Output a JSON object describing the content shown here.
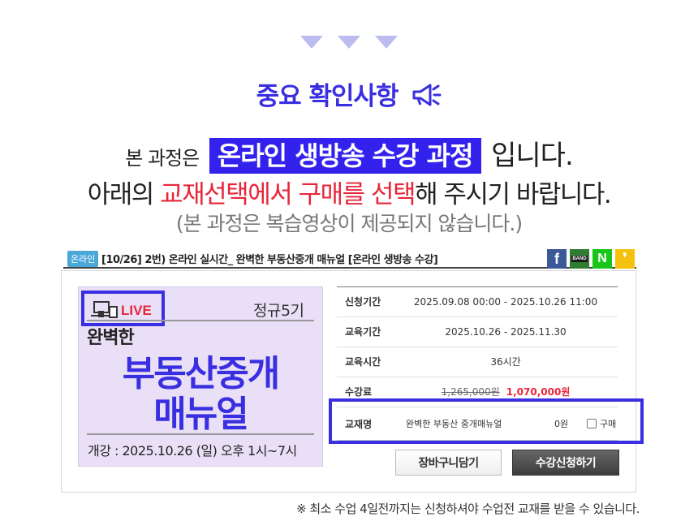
{
  "header": {
    "important_title": "중요 확인사항",
    "line1": {
      "prefix": "본 과정은",
      "highlight": "온라인 생방송 수강 과정",
      "suffix": "입니다."
    },
    "line2": {
      "part1": "아래의 ",
      "red1": "교재선택에서",
      "space": " ",
      "red2": "구매를 선택",
      "part2": "해 주시기 바랍니다."
    },
    "line3": "(본 과정은 복습영상이 제공되지 않습니다.)"
  },
  "course": {
    "badge": "온라인",
    "title": "[10/26] 2번) 온라인 실시간_ 완벽한 부동산중개 매뉴얼 [온라인 생방송 수강]",
    "share": {
      "facebook": "f",
      "band": "BAND",
      "naver": "N",
      "kakao": "❜"
    }
  },
  "thumbnail": {
    "live": "LIVE",
    "regular": "정규5기",
    "perfect": "완벽한",
    "title_line1": "부동산중개",
    "title_line2": "매뉴얼",
    "open_date": "개강 : 2025.10.26 (일) 오후 1시~7시"
  },
  "info": {
    "rows": [
      {
        "label": "신청기간",
        "value": "2025.09.08 00:00 - 2025.10.26 11:00"
      },
      {
        "label": "교육기간",
        "value": "2025.10.26 - 2025.11.30"
      },
      {
        "label": "교육시간",
        "value": "36시간"
      }
    ],
    "fee": {
      "label": "수강료",
      "original": "1,265,000원",
      "sale": "1,070,000원"
    },
    "textbook": {
      "label": "교재명",
      "name": "완벽한 부동산 중개매뉴얼",
      "price": "0원",
      "buy_label": "구매",
      "checked": false
    }
  },
  "buttons": {
    "cart": "장바구니담기",
    "apply": "수강신청하기"
  },
  "notice": "※ 최소 수업 4일전까지는 신청하셔야 수업전 교재를 받을 수 있습니다.",
  "colors": {
    "accent": "#3a2fe0",
    "highlight_bg": "#3322ee",
    "red": "#e8263a",
    "thumb_bg": "#e9e0f7"
  }
}
